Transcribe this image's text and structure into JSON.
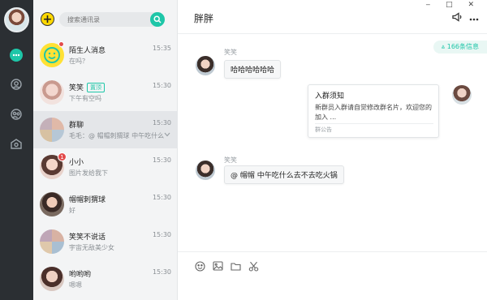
{
  "search": {
    "placeholder": "搜索通讯录"
  },
  "window": {
    "controls": "‒ □ ✕"
  },
  "contacts": [
    {
      "name": "陌生人消息",
      "preview": "在吗？",
      "time": "15:35"
    },
    {
      "name": "笑笑",
      "tag": "置顶",
      "preview": "下午有空吗",
      "time": "15:30"
    },
    {
      "name": "群聊",
      "preview": "毛毛：@ 帽帽刺猬球   中午吃什么",
      "time": "15:30"
    },
    {
      "name": "小小",
      "preview": "图片发给我下",
      "time": "15:30",
      "badge": "1"
    },
    {
      "name": "帽帽刺猬球",
      "preview": "好",
      "time": "15:30"
    },
    {
      "name": "笑笑不说话",
      "preview": "宇宙无敌美少女",
      "time": "15:30"
    },
    {
      "name": "哟哟哟",
      "preview": "嗯嗯",
      "time": "15:30"
    }
  ],
  "chat": {
    "title": "胖胖",
    "unread": "⩓ 166条信息",
    "messages": [
      {
        "sender": "笑笑",
        "text": "哈哈哈哈哈哈"
      },
      {
        "sender": "笑笑",
        "text": "@ 帽帽   中午吃什么去不去吃火锅"
      }
    ],
    "notice": {
      "title": "入群须知",
      "body": "新群员入群请自觉修改群名片，欢迎您的加入 ...",
      "footer": "群公告"
    }
  },
  "colors": {
    "accent": "#1ec6a8",
    "rail": "#2b2f33",
    "badge": "#e24b4b"
  }
}
